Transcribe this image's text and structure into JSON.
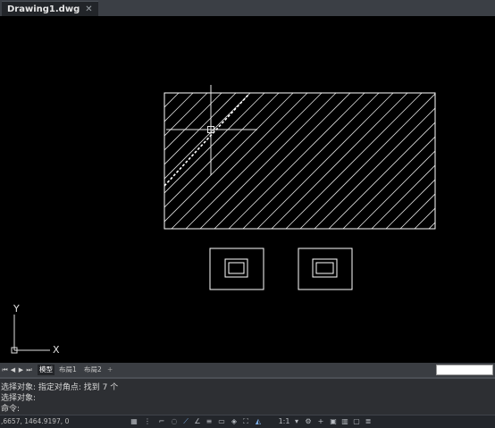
{
  "tabs": [
    {
      "label": "Drawing1.dwg",
      "close": "✕"
    }
  ],
  "layout_tabs": [
    {
      "label": "模型",
      "active": true
    },
    {
      "label": "布局1",
      "active": false
    },
    {
      "label": "布局2",
      "active": false
    },
    {
      "label": "+",
      "active": false
    }
  ],
  "nav_arrows": [
    "⏮",
    "◀",
    "▶",
    "⏭"
  ],
  "ucs": {
    "y_label": "Y",
    "x_label": "X"
  },
  "command_history": [
    "选择对象: 指定对角点: 找到 7 个",
    "选择对象:",
    "命令:"
  ],
  "status": {
    "coordinates": ",6657, 1464.9197, 0",
    "scale": "1:1",
    "icons": [
      "grid-icon",
      "snap-icon",
      "ortho-icon",
      "polar-icon",
      "osnap-icon",
      "otrack-icon",
      "lineweight-icon",
      "transparency-icon",
      "selection-cycling-icon",
      "annotation-scale-icon",
      "annotation-visibility-icon",
      "workspace-gear-icon",
      "plus-icon",
      "isolate-icon",
      "hardware-accel-icon",
      "clean-screen-icon",
      "customize-icon"
    ]
  },
  "colors": {
    "background": "#000000",
    "geometry": "#ffffff",
    "highlight": "#e8e8e8",
    "accent": "#7fb0e8"
  }
}
